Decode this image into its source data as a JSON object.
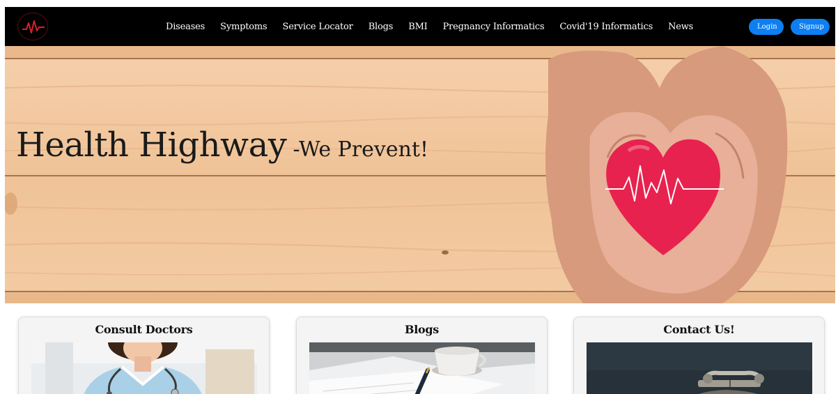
{
  "nav": {
    "logo_icon": "heartbeat-logo-icon",
    "links": [
      "Diseases",
      "Symptoms",
      "Service Locator",
      "Blogs",
      "BMI",
      "Pregnancy Informatics",
      "Covid'19 Informatics",
      "News"
    ],
    "login_label": "Login",
    "signup_label": "Signup"
  },
  "hero": {
    "title": "Health Highway",
    "subtitle": "-We Prevent!"
  },
  "cards": [
    {
      "title": "Consult Doctors",
      "image": "doctor-photo"
    },
    {
      "title": "Blogs",
      "image": "writing-desk-photo"
    },
    {
      "title": "Contact Us!",
      "image": "telephone-photo"
    }
  ],
  "colors": {
    "navbar": "#000000",
    "accent": "#0d7ff2",
    "heart": "#e8224f",
    "wood": "#f2c8a0"
  }
}
